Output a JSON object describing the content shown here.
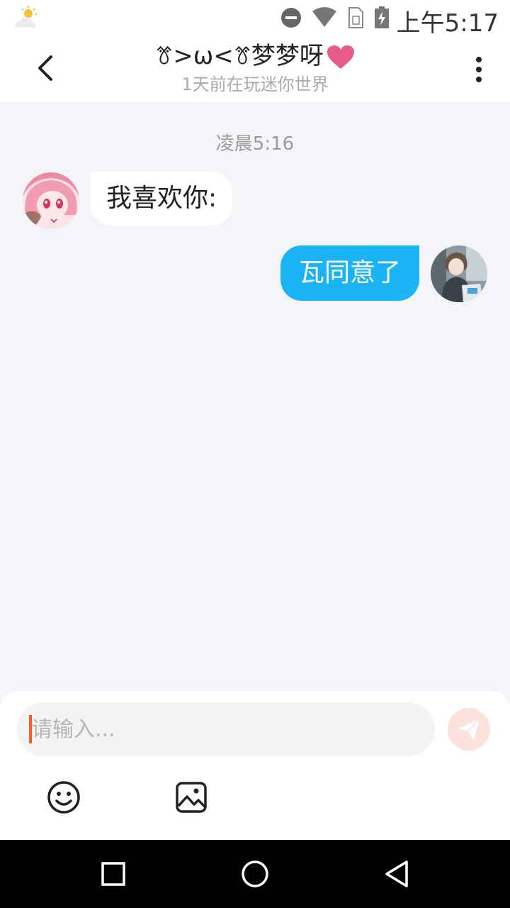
{
  "status_bar": {
    "time": "上午5:17",
    "icons": [
      "weather-icon",
      "do-not-disturb-icon",
      "wifi-icon",
      "sim-icon",
      "battery-charging-icon"
    ]
  },
  "header": {
    "title": "ꔢ>ω<ꔢ梦梦呀",
    "subtitle": "1天前在玩迷你世界",
    "back_icon": "chevron-left-icon",
    "more_icon": "more-vertical-icon"
  },
  "chat": {
    "timestamp": "凌晨5:16",
    "messages": [
      {
        "from": "other",
        "text": "我喜欢你:"
      },
      {
        "from": "me",
        "text": "瓦同意了"
      }
    ]
  },
  "composer": {
    "placeholder": "请输入...",
    "value": "",
    "send_icon": "send-icon",
    "emoji_icon": "emoji-icon",
    "image_icon": "image-icon"
  },
  "colors": {
    "accent": "#1ab3f5",
    "heart": "#e65a8c",
    "send_bg": "#fde1dc",
    "caret": "#ff5a1f"
  }
}
